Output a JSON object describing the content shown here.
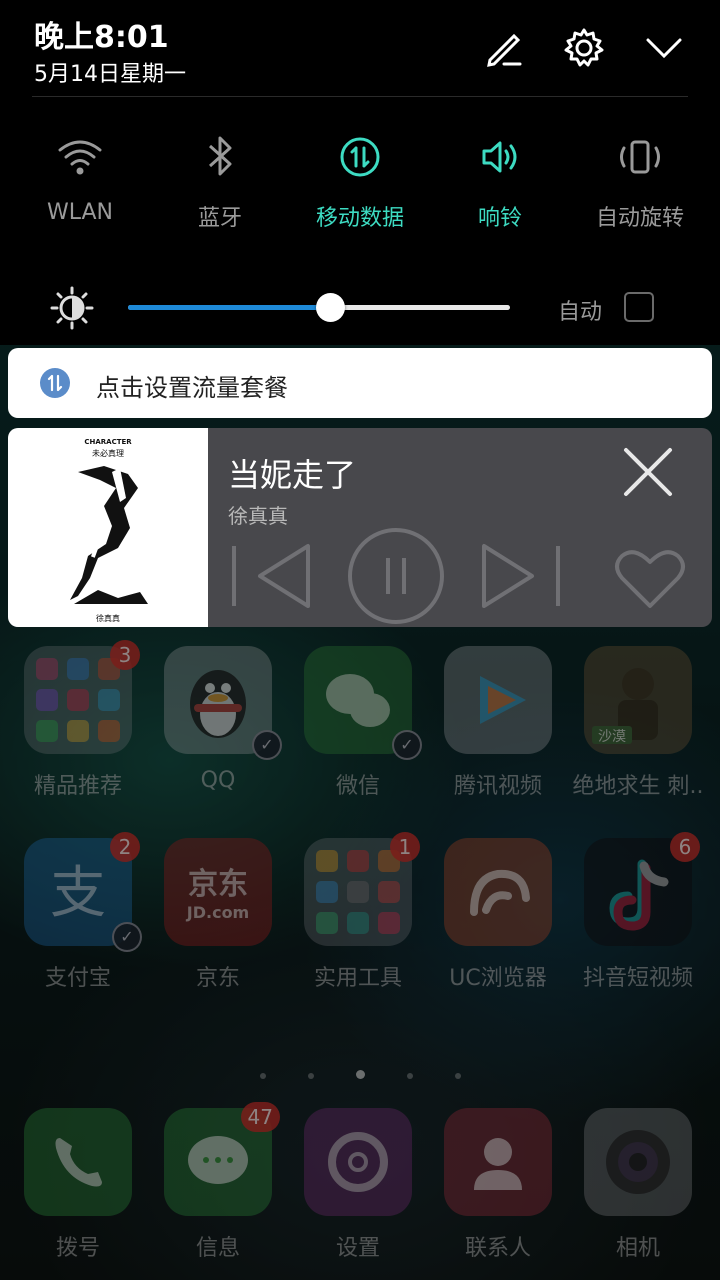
{
  "status": {
    "time": "晚上8:01",
    "date": "5月14日星期一"
  },
  "header_icons": [
    "edit-icon",
    "settings-icon",
    "collapse-icon"
  ],
  "toggles": [
    {
      "label": "WLAN",
      "icon": "wifi-icon",
      "active": false
    },
    {
      "label": "蓝牙",
      "icon": "bluetooth-icon",
      "active": false
    },
    {
      "label": "移动数据",
      "icon": "mobile-data-icon",
      "active": true
    },
    {
      "label": "响铃",
      "icon": "ringer-icon",
      "active": true
    },
    {
      "label": "自动旋转",
      "icon": "auto-rotate-icon",
      "active": false
    }
  ],
  "brightness": {
    "level": 0.53,
    "auto_label": "自动",
    "auto_checked": false
  },
  "data_plan": {
    "text": "点击设置流量套餐"
  },
  "music": {
    "title": "当妮走了",
    "artist": "徐真真",
    "album_art_text": [
      "CHARACTER",
      "未必真理",
      "徐真真"
    ]
  },
  "apps": [
    {
      "label": "精品推荐",
      "badge": "3"
    },
    {
      "label": "QQ",
      "badge": ""
    },
    {
      "label": "微信",
      "badge": ""
    },
    {
      "label": "腾讯视频",
      "badge": ""
    },
    {
      "label": "绝地求生 刺..",
      "badge": ""
    },
    {
      "label": "支付宝",
      "badge": "2"
    },
    {
      "label": "京东",
      "badge": ""
    },
    {
      "label": "实用工具",
      "badge": "1"
    },
    {
      "label": "UC浏览器",
      "badge": ""
    },
    {
      "label": "抖音短视频",
      "badge": "6"
    }
  ],
  "dock": [
    {
      "label": "拨号",
      "badge": ""
    },
    {
      "label": "信息",
      "badge": "47"
    },
    {
      "label": "设置",
      "badge": ""
    },
    {
      "label": "联系人",
      "badge": ""
    },
    {
      "label": "相机",
      "badge": ""
    }
  ],
  "app_text": {
    "jd_logo": "京东",
    "jd_sub": "JD.com",
    "game_tag": "沙漠"
  },
  "colors": {
    "accent": "#3ddbc2",
    "slider": "#1e8ad8",
    "badge": "#d2322d"
  }
}
